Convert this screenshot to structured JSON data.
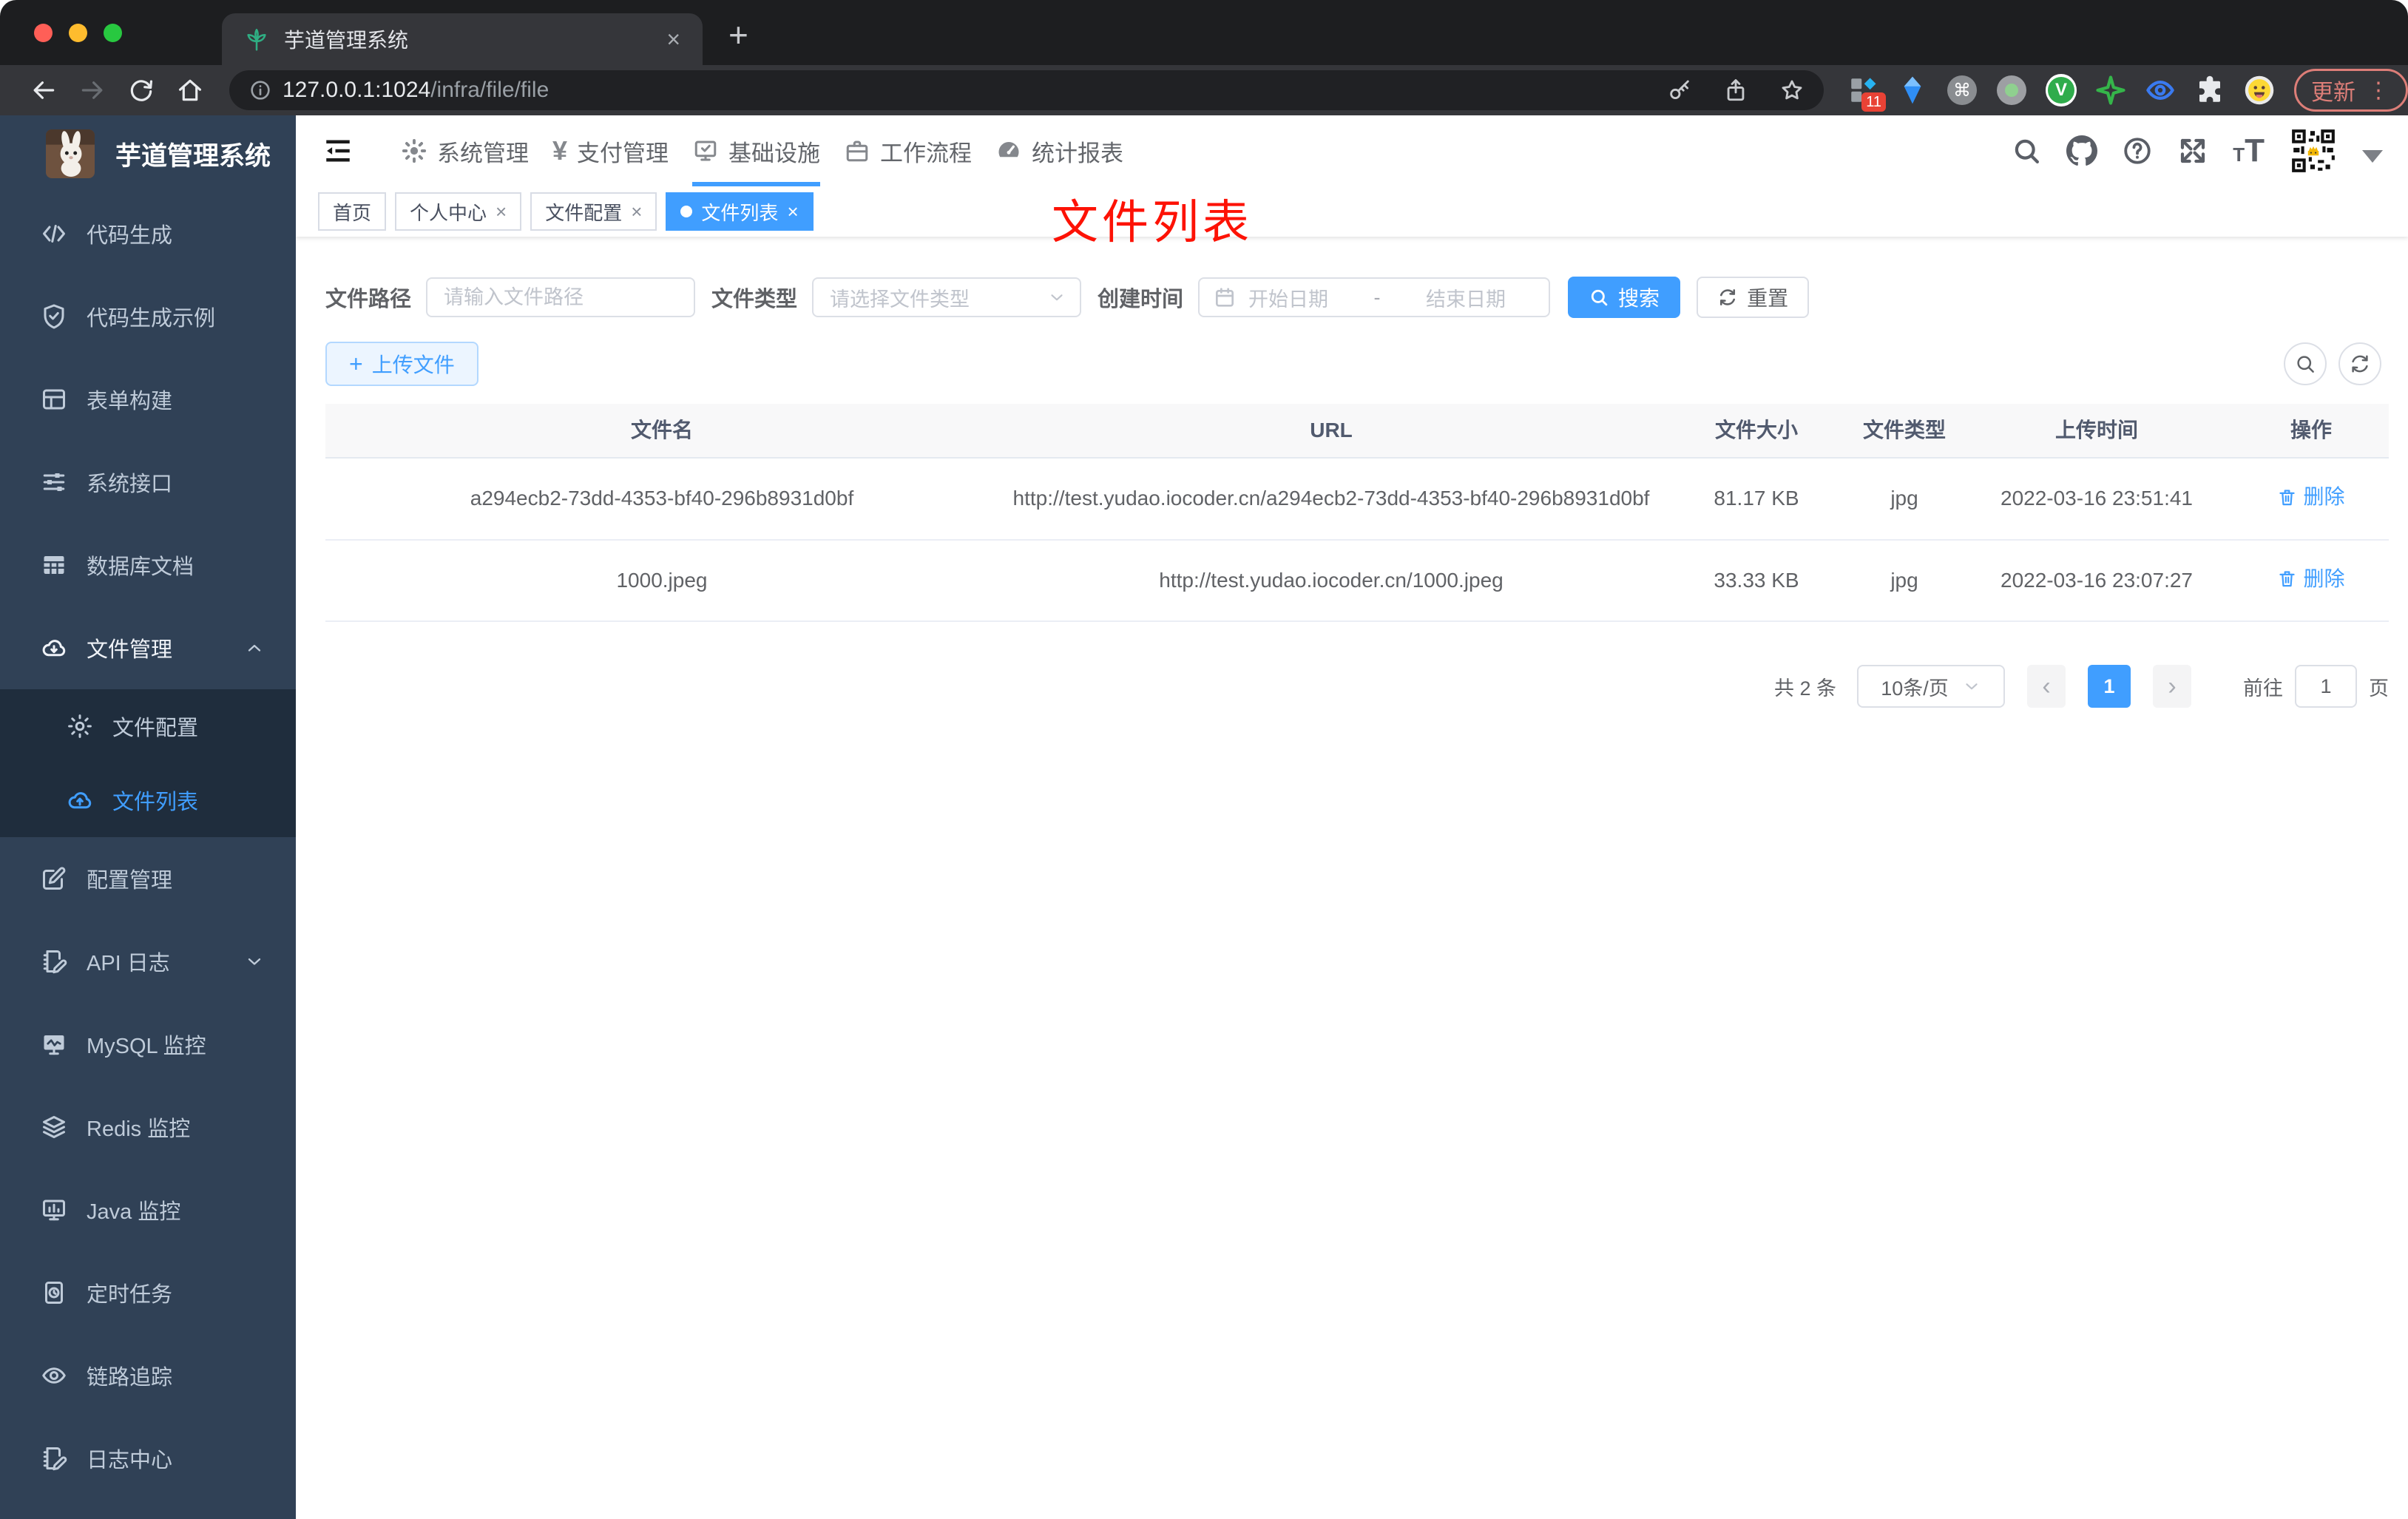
{
  "colors": {
    "accent": "#409eff",
    "sidebar_bg": "#304156",
    "submenu_bg": "#1f2d3d",
    "annotation_red": "#fd1205",
    "update_red": "#dd7e78",
    "tab_active_bg": "#409eff"
  },
  "icons": {
    "close": "×",
    "plus": "+",
    "cmd": "⌘",
    "prev": "‹",
    "next": "›",
    "font_letter": "T",
    "yen": "¥",
    "ellipsis": "⋮"
  },
  "browser": {
    "tab_title": "芋道管理系统",
    "url_host": "127.0.0.1:1024",
    "url_path": "/infra/file/file",
    "update_label": "更新",
    "extension_badge": "11"
  },
  "sidebar": {
    "logo_title": "芋道管理系统",
    "items": [
      {
        "label": "代码生成"
      },
      {
        "label": "代码生成示例"
      },
      {
        "label": "表单构建"
      },
      {
        "label": "系统接口"
      },
      {
        "label": "数据库文档"
      },
      {
        "label": "文件管理"
      },
      {
        "label": "配置管理"
      },
      {
        "label": "API 日志"
      },
      {
        "label": "MySQL 监控"
      },
      {
        "label": "Redis 监控"
      },
      {
        "label": "Java 监控"
      },
      {
        "label": "定时任务"
      },
      {
        "label": "链路追踪"
      },
      {
        "label": "日志中心"
      }
    ],
    "file_submenu": [
      {
        "label": "文件配置"
      },
      {
        "label": "文件列表"
      }
    ]
  },
  "topnav": {
    "items": [
      {
        "label": "系统管理"
      },
      {
        "label": "支付管理"
      },
      {
        "label": "基础设施"
      },
      {
        "label": "工作流程"
      },
      {
        "label": "统计报表"
      }
    ]
  },
  "tags": {
    "items": [
      {
        "label": "首页"
      },
      {
        "label": "个人中心"
      },
      {
        "label": "文件配置"
      },
      {
        "label": "文件列表"
      }
    ]
  },
  "annotation": {
    "text": "文件列表"
  },
  "filter": {
    "path_label": "文件路径",
    "path_placeholder": "请输入文件路径",
    "type_label": "文件类型",
    "type_placeholder": "请选择文件类型",
    "date_label": "创建时间",
    "date_start_placeholder": "开始日期",
    "date_separator": "-",
    "date_end_placeholder": "结束日期",
    "search_label": "搜索",
    "reset_label": "重置"
  },
  "toolbar": {
    "upload_label": "上传文件"
  },
  "table": {
    "headers": [
      "文件名",
      "URL",
      "文件大小",
      "文件类型",
      "上传时间",
      "操作"
    ],
    "rows": [
      {
        "name": "a294ecb2-73dd-4353-bf40-296b8931d0bf",
        "url": "http://test.yudao.iocoder.cn/a294ecb2-73dd-4353-bf40-296b8931d0bf",
        "size": "81.17 KB",
        "type": "jpg",
        "time": "2022-03-16 23:51:41",
        "action": "删除"
      },
      {
        "name": "1000.jpeg",
        "url": "http://test.yudao.iocoder.cn/1000.jpeg",
        "size": "33.33 KB",
        "type": "jpg",
        "time": "2022-03-16 23:07:27",
        "action": "删除"
      }
    ]
  },
  "pagination": {
    "total_text": "共 2 条",
    "page_size": "10条/页",
    "current_page": "1",
    "goto_label": "前往",
    "goto_value": "1",
    "page_unit": "页"
  }
}
